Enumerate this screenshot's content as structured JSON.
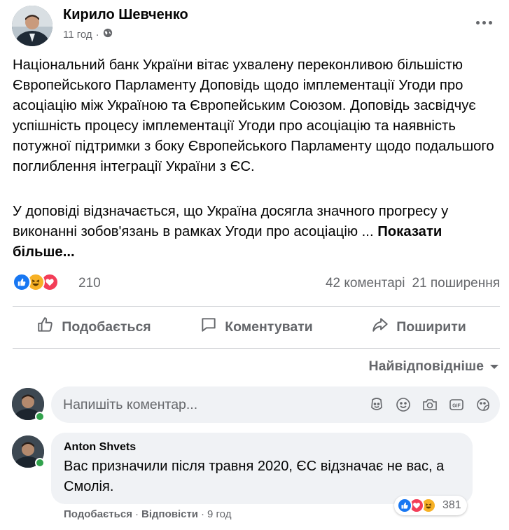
{
  "post": {
    "author": "Кирило Шевченко",
    "time": "11 год",
    "paragraph1": "Національний банк України вітає ухвалену переконливою більшістю Європейського Парламенту Доповідь щодо імплементації Угоди про асоціацію між Україною та Європейським Союзом. Доповідь засвідчує успішність процесу імплементації Угоди про асоціацію та наявність потужної підтримки з боку Європейського Парламенту щодо подальшого поглиблення інтеграції України з ЄС.",
    "paragraph2": "У доповіді відзначається, що Україна досягла значного прогресу у виконанні зобов'язань в рамках Угоди про асоціацію ...",
    "see_more": "Показати більше...",
    "reaction_icons": [
      "like-icon",
      "haha-icon",
      "love-icon"
    ],
    "reaction_count": "210",
    "comments_count": "42 коментарі",
    "shares_count": "21 поширення"
  },
  "actions": {
    "like": "Подобається",
    "comment": "Коментувати",
    "share": "Поширити"
  },
  "sort_label": "Найвідповідніше",
  "comment_input": {
    "placeholder": "Напишіть коментар..."
  },
  "comment": {
    "author": "Anton Shvets",
    "text": "Вас призначили після травня 2020, ЄС відзначає не вас, а Смолія.",
    "reaction_count": "381",
    "like_label": "Подобається",
    "reply_label": "Відповісти",
    "time": "9 год",
    "separator": "·"
  },
  "colors": {
    "like_blue": "#1877f2",
    "love_red": "#f33e58",
    "haha_yellow": "#f7b125",
    "secondary_text": "#65676b",
    "input_bg": "#f0f2f5",
    "online_green": "#31a24c"
  }
}
